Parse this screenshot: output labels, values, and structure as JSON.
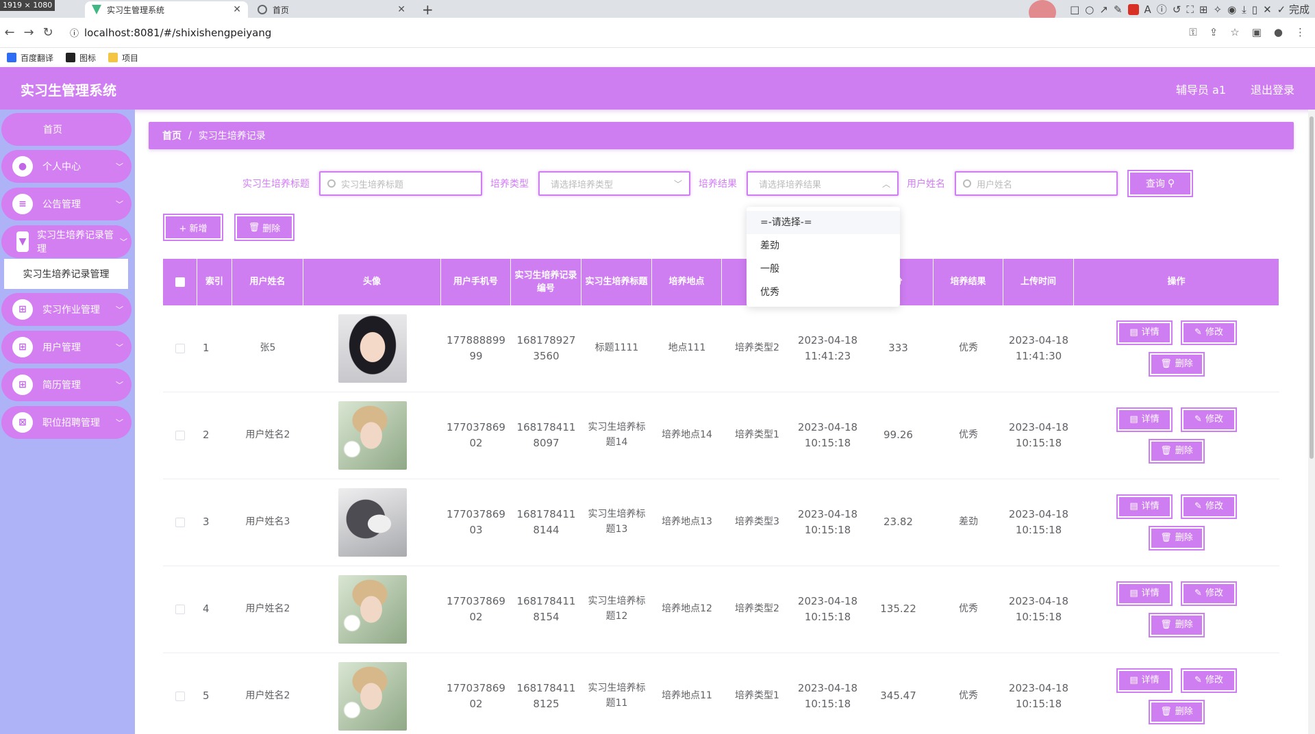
{
  "browser": {
    "size_tag": "1919 × 1080",
    "tabs": [
      {
        "title": "实习生管理系统",
        "active": true
      },
      {
        "title": "首页",
        "active": false
      }
    ],
    "url": "localhost:8081/#/shixishengpeiyang",
    "bookmarks": [
      "百度翻译",
      "图标",
      "项目"
    ],
    "done_label": "完成"
  },
  "header": {
    "title": "实习生管理系统",
    "user": "辅导员 a1",
    "logout": "退出登录"
  },
  "sidebar": {
    "home": "首页",
    "items": [
      {
        "label": "个人中心",
        "icon": "user-icon"
      },
      {
        "label": "公告管理",
        "icon": "list-icon"
      },
      {
        "label": "实习生培养记录管理",
        "icon": "cup-icon"
      },
      {
        "label": "实习作业管理",
        "icon": "grid-icon"
      },
      {
        "label": "用户管理",
        "icon": "grid-icon"
      },
      {
        "label": "简历管理",
        "icon": "grid-icon"
      },
      {
        "label": "职位招聘管理",
        "icon": "close-grid-icon"
      }
    ],
    "active_submenu": "实习生培养记录管理"
  },
  "breadcrumb": {
    "home": "首页",
    "sep": "/",
    "current": "实习生培养记录"
  },
  "filters": {
    "title_label": "实习生培养标题",
    "title_placeholder": "实习生培养标题",
    "type_label": "培养类型",
    "type_placeholder": "请选择培养类型",
    "result_label": "培养结果",
    "result_placeholder": "请选择培养结果",
    "username_label": "用户姓名",
    "username_placeholder": "用户姓名",
    "query": "查询"
  },
  "actions": {
    "add": "+ 新增",
    "delete": "删除"
  },
  "dropdown": {
    "options": [
      "=-请选择-=",
      "差劲",
      "一般",
      "优秀"
    ]
  },
  "table": {
    "headers": [
      "索引",
      "用户姓名",
      "头像",
      "用户手机号",
      "实习生培养记录编号",
      "实习生培养标题",
      "培养地点",
      "培",
      "",
      "分",
      "培养结果",
      "上传时间",
      "操作"
    ],
    "rows": [
      {
        "index": "1",
        "name": "张5",
        "avatar": "girl",
        "phone": "17788889999",
        "record_no": "1681789273560",
        "title": "标题1111",
        "place": "地点111",
        "type": "培养类型2",
        "time": "2023-04-18 11:41:23",
        "score": "333",
        "result": "优秀",
        "upload": "2023-04-18 11:41:30"
      },
      {
        "index": "2",
        "name": "用户姓名2",
        "avatar": "man",
        "phone": "17703786902",
        "record_no": "1681784118097",
        "title": "实习生培养标题14",
        "place": "培养地点14",
        "type": "培养类型1",
        "time": "2023-04-18 10:15:18",
        "score": "99.26",
        "result": "优秀",
        "upload": "2023-04-18 10:15:18"
      },
      {
        "index": "3",
        "name": "用户姓名3",
        "avatar": "dog",
        "phone": "17703786903",
        "record_no": "1681784118144",
        "title": "实习生培养标题13",
        "place": "培养地点13",
        "type": "培养类型3",
        "time": "2023-04-18 10:15:18",
        "score": "23.82",
        "result": "差劲",
        "upload": "2023-04-18 10:15:18"
      },
      {
        "index": "4",
        "name": "用户姓名2",
        "avatar": "man",
        "phone": "17703786902",
        "record_no": "1681784118154",
        "title": "实习生培养标题12",
        "place": "培养地点12",
        "type": "培养类型2",
        "time": "2023-04-18 10:15:18",
        "score": "135.22",
        "result": "优秀",
        "upload": "2023-04-18 10:15:18"
      },
      {
        "index": "5",
        "name": "用户姓名2",
        "avatar": "man",
        "phone": "17703786902",
        "record_no": "1681784118125",
        "title": "实习生培养标题11",
        "place": "培养地点11",
        "type": "培养类型1",
        "time": "2023-04-18 10:15:18",
        "score": "345.47",
        "result": "优秀",
        "upload": "2023-04-18 10:15:18"
      }
    ],
    "op_labels": {
      "detail": "详情",
      "edit": "修改",
      "delete": "删除"
    }
  }
}
